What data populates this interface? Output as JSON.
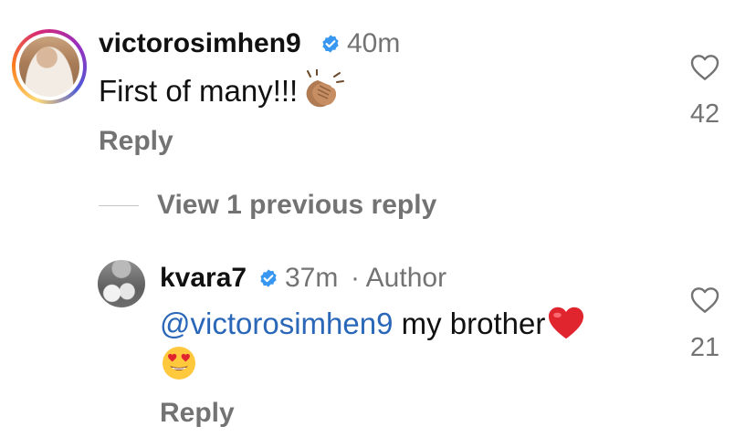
{
  "comments": [
    {
      "username": "victorosimhen9",
      "verified": true,
      "time": "40m",
      "text": "First of many!!!",
      "text_emoji": "clapping-hands-medium-dark-skin",
      "reply_label": "Reply",
      "likes": "42"
    },
    {
      "username": "kvara7",
      "verified": true,
      "time": "37m",
      "author_label": "· Author",
      "mention": "@victorosimhen9",
      "text": " my brother",
      "text_emoji": [
        "red-heart",
        "heart-eyes-face"
      ],
      "reply_label": "Reply",
      "likes": "21"
    }
  ],
  "view_replies_label": "View 1 previous reply",
  "colors": {
    "mention_blue": "#2a67b8",
    "verified_blue": "#3897f0",
    "secondary_gray": "#737373"
  }
}
